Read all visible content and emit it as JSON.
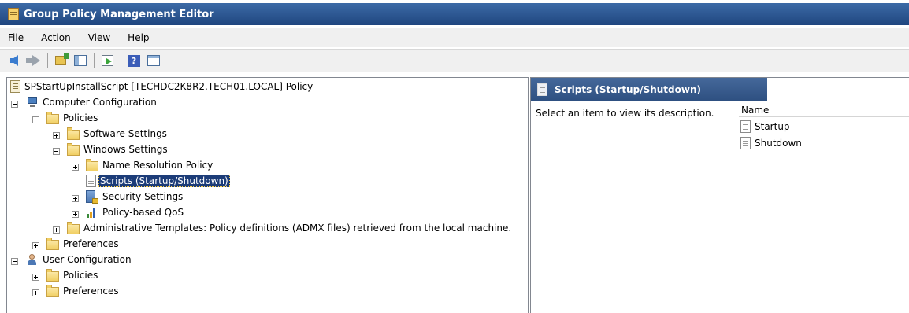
{
  "window": {
    "title": "Group Policy Management Editor"
  },
  "menu": [
    "File",
    "Action",
    "View",
    "Help"
  ],
  "toolbar": {
    "buttons": [
      "back-icon",
      "forward-icon",
      "up-folder-icon",
      "show-hide-tree-icon",
      "export-list-icon",
      "help-icon",
      "view-icon"
    ]
  },
  "tree": {
    "root": "SPStartUpInstallScript [TECHDC2K8R2.TECH01.LOCAL] Policy",
    "computer_config": "Computer Configuration",
    "policies": "Policies",
    "software_settings": "Software Settings",
    "windows_settings": "Windows Settings",
    "name_resolution": "Name Resolution Policy",
    "scripts": "Scripts (Startup/Shutdown)",
    "security_settings": "Security Settings",
    "qos": "Policy-based QoS",
    "admin_templates": "Administrative Templates: Policy definitions (ADMX files) retrieved from the local machine.",
    "preferences": "Preferences",
    "user_config": "User Configuration",
    "user_policies": "Policies",
    "user_preferences": "Preferences"
  },
  "details": {
    "header": "Scripts (Startup/Shutdown)",
    "description": "Select an item to view its description.",
    "column_name": "Name",
    "items": [
      "Startup",
      "Shutdown"
    ]
  }
}
